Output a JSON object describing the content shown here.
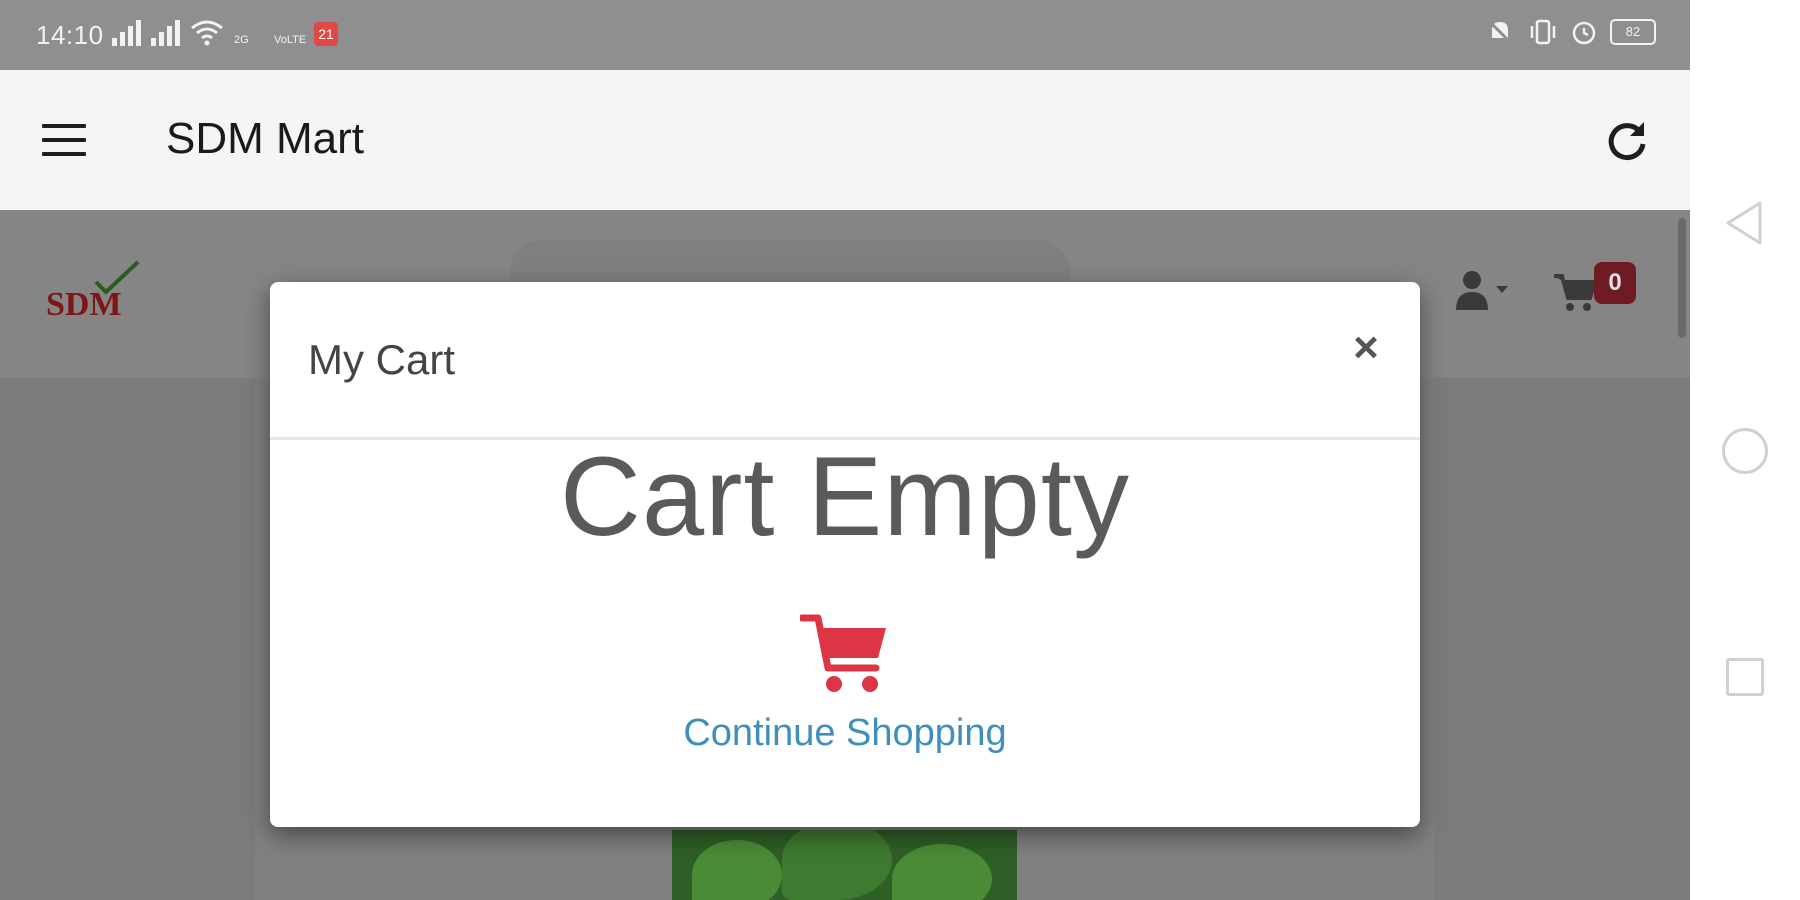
{
  "status_bar": {
    "time": "14:10",
    "network_labels": [
      "2G",
      "VoLTE"
    ],
    "notification_count": "21",
    "battery": "82"
  },
  "app_bar": {
    "title": "SDM Mart",
    "menu_icon": "hamburger-menu-icon",
    "refresh_icon": "refresh-icon"
  },
  "site_header": {
    "logo_text": "SDM",
    "cart_count": "0"
  },
  "modal": {
    "title": "My Cart",
    "close_label": "×",
    "empty_message": "Cart Empty",
    "continue_label": "Continue Shopping"
  },
  "colors": {
    "accent_red": "#dc3545",
    "link_blue": "#3f8fbd",
    "badge_dark_red": "#6e1b24"
  }
}
